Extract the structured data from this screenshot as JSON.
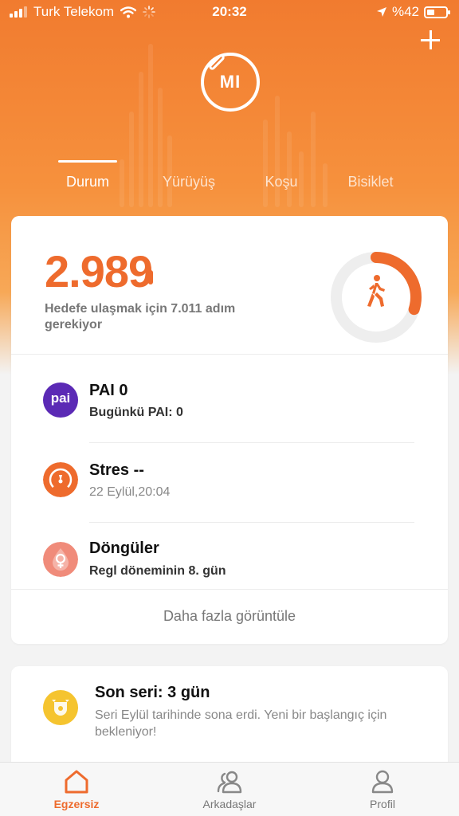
{
  "status_bar": {
    "carrier": "Turk Telekom",
    "time": "20:32",
    "battery": "%42",
    "battery_level": 0.42
  },
  "tabs": [
    "Durum",
    "Yürüyüş",
    "Koşu",
    "Bisiklet"
  ],
  "active_tab": "Durum",
  "steps": {
    "count": "2.989",
    "goal_text": "Hedefe ulaşmak için 7.011 adım gerekiyor",
    "progress": 0.2989
  },
  "pai": {
    "title": "PAI 0",
    "subtitle": "Bugünkü PAI: 0",
    "badge": "pai"
  },
  "stress": {
    "title": "Stres --",
    "subtitle": "22 Eylül,20:04"
  },
  "cycles": {
    "title": "Döngüler",
    "subtitle": "Regl döneminin 8. gün"
  },
  "more_label": "Daha fazla görüntüle",
  "streak": {
    "title": "Son seri: 3 gün",
    "subtitle": "Seri Eylül tarihinde sona erdi. Yeni bir başlangıç için bekleniyor!"
  },
  "bottom_nav": [
    {
      "label": "Egzersiz",
      "icon": "home-icon",
      "active": true
    },
    {
      "label": "Arkadaşlar",
      "icon": "friends-icon",
      "active": false
    },
    {
      "label": "Profil",
      "icon": "profile-icon",
      "active": false
    }
  ],
  "colors": {
    "accent": "#ee6b2d",
    "hero_top": "#f17b2f",
    "pai_purple": "#5b2ab5",
    "streak_yellow": "#f5c42f",
    "cycle_pink": "#f08b7a"
  }
}
